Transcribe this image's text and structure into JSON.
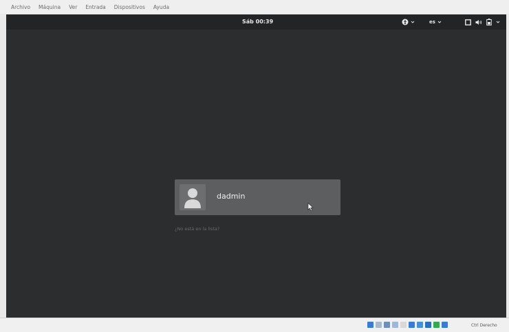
{
  "menubar": {
    "items": [
      "Archivo",
      "Máquina",
      "Ver",
      "Entrada",
      "Dispositivos",
      "Ayuda"
    ]
  },
  "topbar": {
    "clock": "Sáb 00:39",
    "keyboard_layout": "es",
    "accessibility_icon": "accessibility-icon",
    "display_icon": "display-icon",
    "volume_icon": "volume-icon",
    "battery_icon": "battery-icon",
    "power_menu_icon": "chevron-down-icon"
  },
  "login": {
    "username": "dadmin",
    "not_listed_link": "¿No está en la lista?",
    "avatar_icon": "user-avatar-icon"
  },
  "statusbar": {
    "host_key_label": "Ctrl Derecho",
    "tray_icons": [
      "hard-disk-icon",
      "optical-drive-icon",
      "audio-icon",
      "usb-icon",
      "shared-folders-icon",
      "display-icon",
      "network-icon",
      "recording-icon",
      "mouse-integration-icon",
      "cpu-icon"
    ],
    "tray_colors": [
      "#3b7bd1",
      "#a9b9c9",
      "#6e8fb8",
      "#a0b6d4",
      "#d8d8d8",
      "#3b7bd1",
      "#4a8ed6",
      "#2d6fbf",
      "#35a853",
      "#3b7bd1"
    ]
  },
  "colors": {
    "desktop_bg": "#2c2d2f",
    "topbar_bg": "#232426",
    "card_bg": "#5d5e60"
  }
}
